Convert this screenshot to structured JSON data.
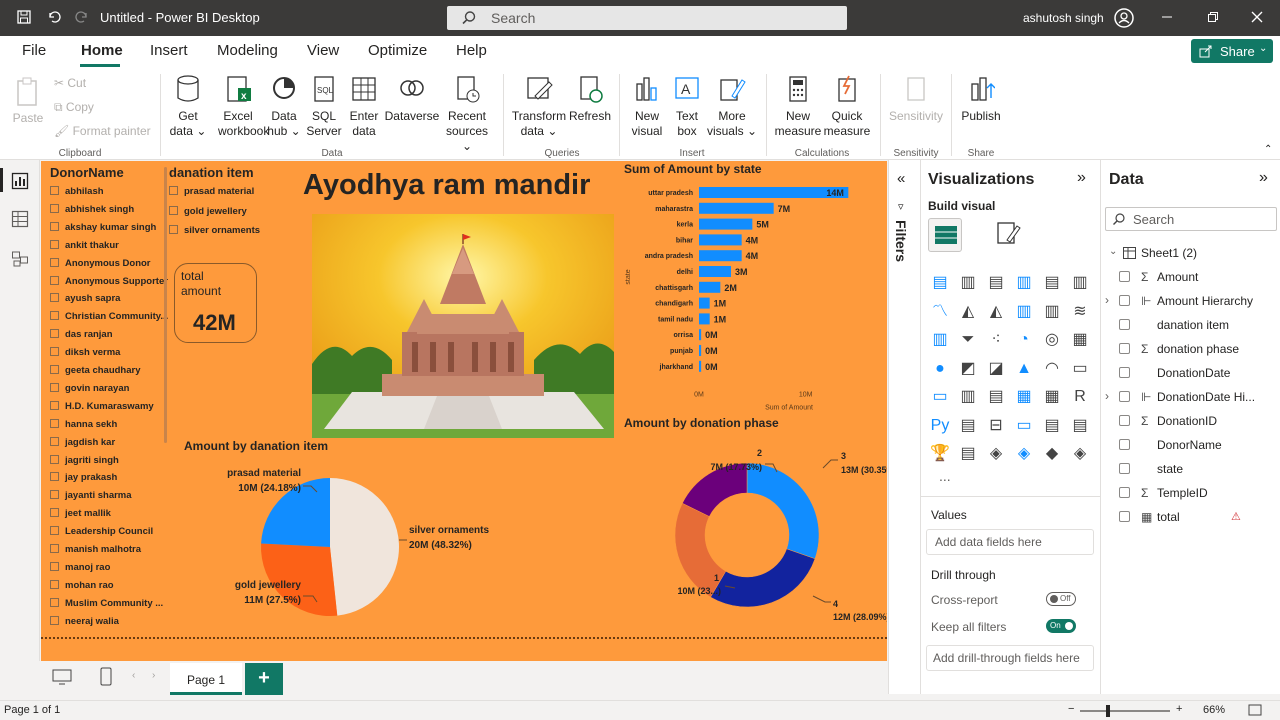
{
  "titlebar": {
    "title": "Untitled - Power BI Desktop",
    "search_placeholder": "Search",
    "user": "ashutosh singh"
  },
  "menu": {
    "file": "File",
    "home": "Home",
    "insert": "Insert",
    "modeling": "Modeling",
    "view": "View",
    "optimize": "Optimize",
    "help": "Help",
    "share": "Share"
  },
  "ribbon": {
    "paste": "Paste",
    "cut": "Cut",
    "copy": "Copy",
    "format_painter": "Format painter",
    "clipboard": "Clipboard",
    "get_data_1": "Get",
    "get_data_2": "data",
    "excel_1": "Excel",
    "excel_2": "workbook",
    "datahub_1": "Data",
    "datahub_2": "hub",
    "sql_1": "SQL",
    "sql_2": "Server",
    "enter_1": "Enter",
    "enter_2": "data",
    "dataverse": "Dataverse",
    "recent_1": "Recent",
    "recent_2": "sources",
    "data_group": "Data",
    "transform_1": "Transform",
    "transform_2": "data",
    "refresh": "Refresh",
    "queries": "Queries",
    "newvisual_1": "New",
    "newvisual_2": "visual",
    "textbox_1": "Text",
    "textbox_2": "box",
    "morevisuals_1": "More",
    "morevisuals_2": "visuals",
    "insert_group": "Insert",
    "newmeasure_1": "New",
    "newmeasure_2": "measure",
    "quick_1": "Quick",
    "quick_2": "measure",
    "calculations": "Calculations",
    "sensitivity": "Sensitivity",
    "sensitivity_group": "Sensitivity",
    "publish": "Publish",
    "share_group": "Share"
  },
  "report": {
    "donor_header": "DonorName",
    "donors": [
      "abhilash",
      "abhishek singh",
      "akshay kumar singh",
      "ankit thakur",
      "Anonymous Donor",
      "Anonymous Supporter",
      "ayush sapra",
      "Christian Community...",
      "das ranjan",
      "diksh verma",
      "geeta chaudhary",
      "govin narayan",
      "H.D. Kumaraswamy",
      "hanna sekh",
      "jagdish kar",
      "jagriti singh",
      "jay prakash",
      "jayanti sharma",
      "jeet mallik",
      "Leadership Council",
      "manish malhotra",
      "manoj rao",
      "mohan rao",
      "Muslim Community ...",
      "neeraj walia"
    ],
    "item_header": "danation item",
    "items": [
      "prasad material",
      "gold jewellery",
      "silver ornaments"
    ],
    "title": "Ayodhya ram mandir",
    "card_label_1": "total",
    "card_label_2": "amount",
    "card_value": "42M"
  },
  "chart_data": [
    {
      "type": "bar",
      "title": "Sum of Amount by state",
      "ylabel": "state",
      "xlabel": "Sum of Amount",
      "categories": [
        "uttar pradesh",
        "maharastra",
        "kerla",
        "bihar",
        "andra pradesh",
        "delhi",
        "chattisgarh",
        "chandigarh",
        "tamil nadu",
        "orrisa",
        "punjab",
        "jharkhand"
      ],
      "values": [
        14,
        7,
        5,
        4,
        4,
        3,
        2,
        1,
        1,
        0.2,
        0.2,
        0.2
      ],
      "labels": [
        "14M",
        "7M",
        "5M",
        "4M",
        "4M",
        "3M",
        "2M",
        "1M",
        "1M",
        "0M",
        "0M",
        "0M"
      ],
      "xticks": [
        "0M",
        "10M"
      ],
      "xlim": [
        0,
        15
      ],
      "color": "#118dff"
    },
    {
      "type": "pie",
      "title": "Amount by danation item",
      "slices": [
        {
          "name": "silver ornaments",
          "value": 48.32,
          "label": "20M (48.32%)",
          "color": "#f0e5dc"
        },
        {
          "name": "gold jewellery",
          "value": 27.5,
          "label": "11M (27.5%)",
          "color": "#fc6117"
        },
        {
          "name": "prasad material",
          "value": 24.18,
          "label": "10M (24.18%)",
          "color": "#118dff"
        }
      ]
    },
    {
      "type": "pie",
      "title": "Amount by donation phase",
      "donut": true,
      "slices": [
        {
          "name": "3",
          "value": 30.35,
          "label": "13M (30.35%)",
          "color": "#118dff"
        },
        {
          "name": "4",
          "value": 28.09,
          "label": "12M (28.09%)",
          "color": "#12239e"
        },
        {
          "name": "1",
          "value": 23.83,
          "label": "10M (23...)",
          "color": "#e66c37"
        },
        {
          "name": "2",
          "value": 17.73,
          "label": "7M (17.73%)",
          "color": "#6b007b"
        }
      ]
    }
  ],
  "filters": {
    "label": "Filters"
  },
  "viz": {
    "title": "Visualizations",
    "build": "Build visual",
    "values": "Values",
    "values_placeholder": "Add data fields here",
    "drill": "Drill through",
    "cross": "Cross-report",
    "cross_state": "Off",
    "keep": "Keep all filters",
    "keep_state": "On",
    "drill_placeholder": "Add drill-through fields here",
    "more": "..."
  },
  "datapane": {
    "title": "Data",
    "search_placeholder": "Search",
    "table": "Sheet1 (2)",
    "fields": [
      "Amount",
      "Amount Hierarchy",
      "danation item",
      "donation phase",
      "DonationDate",
      "DonationDate Hi...",
      "DonationID",
      "DonorName",
      "state",
      "TempleID",
      "total"
    ]
  },
  "pages": {
    "page1": "Page 1",
    "add": "+"
  },
  "status": {
    "page": "Page 1 of 1",
    "zoom": "66%"
  },
  "colors": {
    "accent": "#117865",
    "canvas": "#fe9a3c",
    "bar": "#118dff"
  }
}
